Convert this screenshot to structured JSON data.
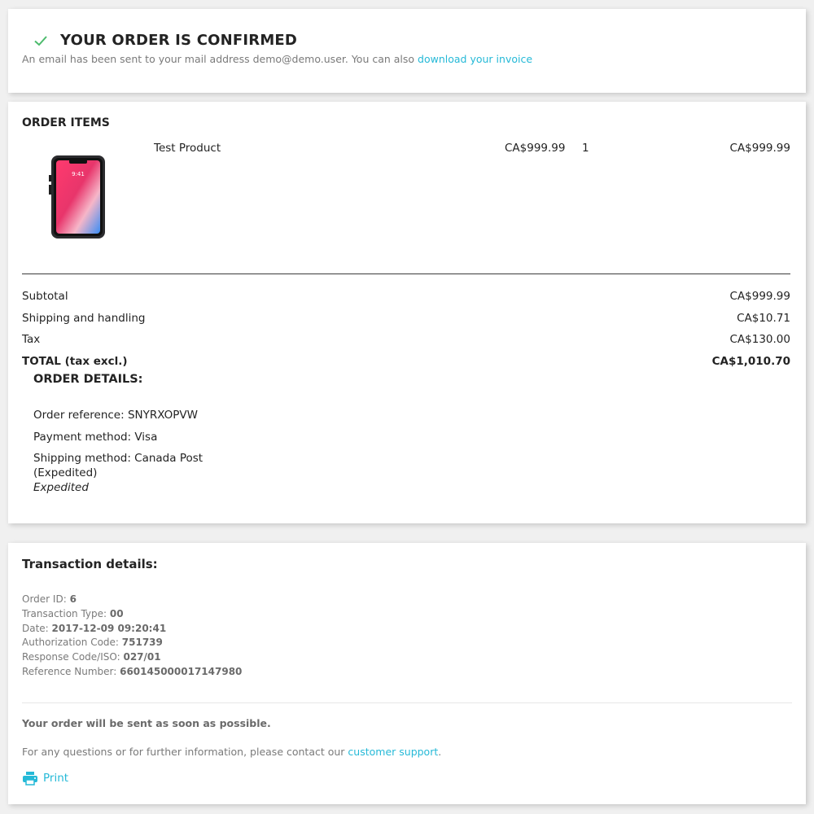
{
  "confirmation": {
    "title": "YOUR ORDER IS CONFIRMED",
    "email_text": "An email has been sent to your mail address demo@demo.user. You can also ",
    "invoice_link": "download your invoice",
    "icon": "check-icon"
  },
  "order_items": {
    "title": "ORDER ITEMS",
    "items": [
      {
        "name": "Test Product",
        "unit_price": "CA$999.99",
        "quantity": "1",
        "total": "CA$999.99",
        "image": "smartphone-image"
      }
    ],
    "summary": {
      "subtotal_label": "Subtotal",
      "subtotal_value": "CA$999.99",
      "shipping_label": "Shipping and handling",
      "shipping_value": "CA$10.71",
      "tax_label": "Tax",
      "tax_value": "CA$130.00",
      "total_label": "TOTAL (tax excl.)",
      "total_value": "CA$1,010.70"
    }
  },
  "order_details": {
    "title": "ORDER DETAILS:",
    "reference": "Order reference: SNYRXOPVW",
    "payment": "Payment method: Visa",
    "shipping_line1": "Shipping method: Canada Post",
    "shipping_line2": "(Expedited)",
    "shipping_note": "Expedited"
  },
  "transaction": {
    "title": "Transaction details:",
    "rows": [
      {
        "label": "Order ID: ",
        "value": "6"
      },
      {
        "label": "Transaction Type: ",
        "value": "00"
      },
      {
        "label": "Date: ",
        "value": "2017-12-09 09:20:41"
      },
      {
        "label": "Authorization Code: ",
        "value": "751739"
      },
      {
        "label": "Response Code/ISO: ",
        "value": "027/01"
      },
      {
        "label": "Reference Number: ",
        "value": "660145000017147980"
      }
    ],
    "soon_text": "Your order will be sent as soon as possible.",
    "contact_text": "For any questions or for further information, please contact our ",
    "support_link": "customer support",
    "contact_suffix": ".",
    "print_label": "Print",
    "print_icon": "printer-icon"
  },
  "colors": {
    "accent": "#25b9d7",
    "success": "#4cbb6c",
    "background": "#f0f0f0",
    "card": "#ffffff"
  }
}
